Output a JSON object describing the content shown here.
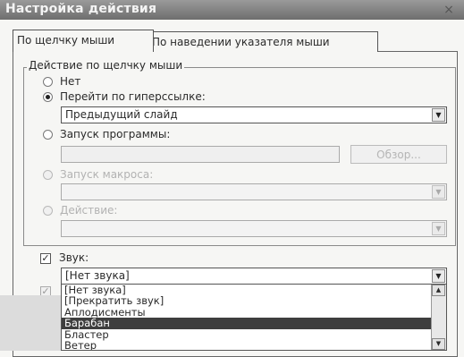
{
  "window": {
    "title": "Настройка действия",
    "close": "×"
  },
  "tabs": [
    {
      "label": "По щелчку мыши"
    },
    {
      "label": "По наведении указателя мыши"
    }
  ],
  "group": {
    "title": "Действие по щелчку мыши",
    "options": {
      "none": "Нет",
      "hyperlink": "Перейти по гиперссылке:",
      "run_program": "Запуск программы:",
      "run_macro": "Запуск макроса:",
      "action": "Действие:"
    },
    "selected": "hyperlink",
    "hyperlink_value": "Предыдущий слайд",
    "program_path": "",
    "browse_label": "Обзор..."
  },
  "sound": {
    "label": "Звук:",
    "checked": true,
    "value": "[Нет звука]",
    "list": [
      "[Нет звука]",
      "[Прекратить звук]",
      "Аплодисменты",
      "Барабан",
      "Бластер",
      "Ветер"
    ],
    "selected_index": 3
  },
  "icons": {
    "arrow": "▼",
    "up": "▲",
    "check": "✓"
  }
}
